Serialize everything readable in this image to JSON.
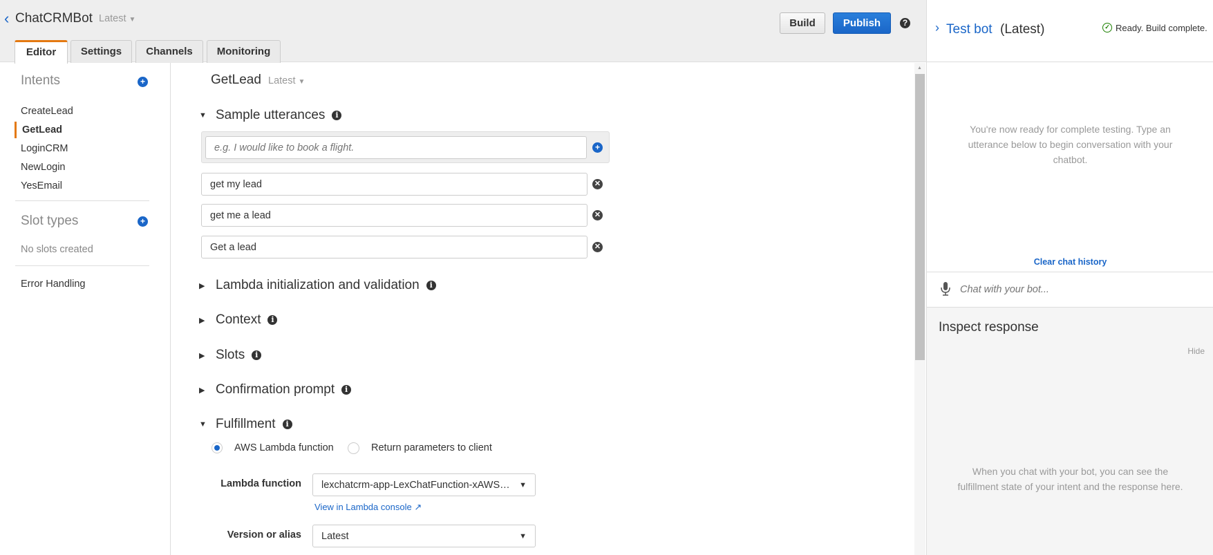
{
  "header": {
    "back_icon": "chevron-left",
    "bot_name": "ChatCRMBot",
    "version": "Latest",
    "build": "Build",
    "publish": "Publish",
    "help_icon": "question-circle"
  },
  "tabs": [
    "Editor",
    "Settings",
    "Channels",
    "Monitoring"
  ],
  "sidebar": {
    "intents_title": "Intents",
    "intents": [
      "CreateLead",
      "GetLead",
      "LoginCRM",
      "NewLogin",
      "YesEmail"
    ],
    "slot_types_title": "Slot types",
    "no_slots": "No slots created",
    "error_handling": "Error Handling"
  },
  "main": {
    "intent_name": "GetLead",
    "intent_version": "Latest",
    "sections": {
      "sample_utterances": "Sample utterances",
      "lambda_init": "Lambda initialization and validation",
      "context": "Context",
      "slots": "Slots",
      "confirmation": "Confirmation prompt",
      "fulfillment": "Fulfillment"
    },
    "utterance_placeholder": "e.g. I would like to book a flight.",
    "utterances": [
      "get my lead",
      "get me a lead",
      "Get a lead"
    ],
    "fulfillment": {
      "option_lambda": "AWS Lambda function",
      "option_return": "Return parameters to client",
      "selected": "AWS Lambda function",
      "lambda_label": "Lambda function",
      "lambda_value": "lexchatcrm-app-LexChatFunction-xAWS…",
      "console_link": "View in Lambda console",
      "version_label": "Version or alias",
      "version_value": "Latest"
    }
  },
  "test_bot": {
    "title": "Test bot",
    "version": "(Latest)",
    "status": "Ready. Build complete.",
    "ready_message": "You're now ready for complete testing. Type an utterance below to begin conversation with your chatbot.",
    "clear_history": "Clear chat history",
    "chat_placeholder": "Chat with your bot...",
    "inspect_title": "Inspect response",
    "hide": "Hide",
    "inspect_message": "When you chat with your bot, you can see the fulfillment state of your intent and the response here."
  },
  "colors": {
    "accent": "#1a66c8",
    "tab_active": "#e47911",
    "status": "#1d8102"
  }
}
